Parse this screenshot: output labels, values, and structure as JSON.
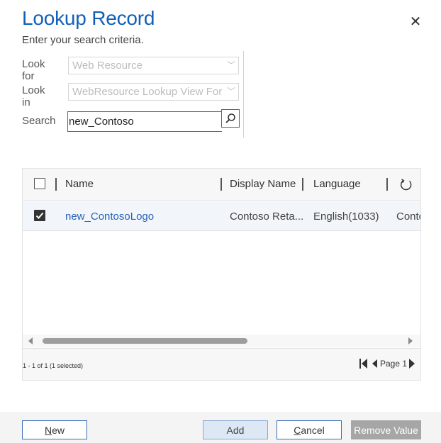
{
  "dialog": {
    "title": "Lookup Record",
    "subtitle": "Enter your search criteria.",
    "close_glyph": "✕"
  },
  "form": {
    "look_for_label": "Look for",
    "look_for_value": "Web Resource",
    "look_in_label": "Look in",
    "look_in_value": "WebResource Lookup View For",
    "search_label": "Search",
    "search_value": "new_Contoso"
  },
  "grid": {
    "columns": [
      "Name",
      "Display Name",
      "Language"
    ],
    "rows": [
      {
        "selected": true,
        "name": "new_ContosoLogo",
        "display_name": "Contoso Reta...",
        "language": "English(1033)",
        "extra": "Conto"
      }
    ],
    "scroll_thumb_fraction": 0.51,
    "count_text": "1 - 1 of 1 (1 selected)",
    "page_label": "Page 1"
  },
  "buttons": {
    "new": {
      "underlined": "N",
      "rest": "ew"
    },
    "add": "Add",
    "cancel": {
      "underlined": "C",
      "rest": "ancel"
    },
    "remove": "Remove Value"
  },
  "colors": {
    "title": "#1160b7",
    "link": "#2862b8",
    "button_border": "#3a6eb5",
    "disabled_button": "#a6a6a6"
  },
  "icons": {
    "close": "close-icon",
    "search": "search-icon",
    "chevron": "chevron-down-icon",
    "refresh": "refresh-icon",
    "first_page": "first-page-icon",
    "prev_page": "prev-page-icon",
    "next_page": "next-page-icon"
  }
}
